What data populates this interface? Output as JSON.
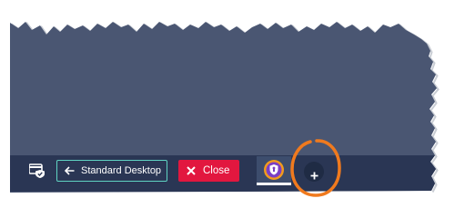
{
  "taskbar": {
    "desktop_icon": "secure-desktop-icon",
    "standard_desktop": {
      "icon": "arrow-left-icon",
      "label": "Standard Desktop"
    },
    "close": {
      "icon": "close-x-icon",
      "label": "Close"
    },
    "active_app_icon": "avast-secureline-vpn-icon",
    "add_button_icon": "plus-icon"
  },
  "annotation": {
    "shape": "circle",
    "target": "add-button",
    "color": "#f07a1e"
  },
  "colors": {
    "desktop_background": "#4a5672",
    "taskbar": "#2a3654",
    "accent_border": "#5fd3c2",
    "close_button": "#e2173f",
    "annotation": "#f07a1e"
  }
}
